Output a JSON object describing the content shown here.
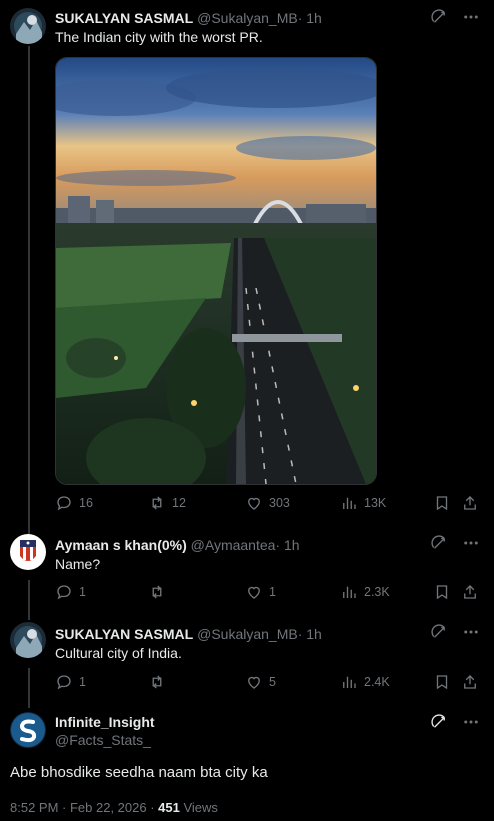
{
  "tweets": [
    {
      "name": "SUKALYAN SASMAL",
      "handle": "@Sukalyan_MB",
      "dot": "·",
      "time": "1h",
      "text": "The Indian city with the worst PR.",
      "replies": "16",
      "retweets": "12",
      "likes": "303",
      "views": "13K"
    },
    {
      "name": "Aymaan s khan(0%)",
      "handle": "@Aymaantea",
      "dot": "·",
      "time": "1h",
      "text": "Name?",
      "replies": "1",
      "retweets": "",
      "likes": "1",
      "views": "2.3K"
    },
    {
      "name": "SUKALYAN SASMAL",
      "handle": "@Sukalyan_MB",
      "dot": "·",
      "time": "1h",
      "text": "Cultural city of India.",
      "replies": "1",
      "retweets": "",
      "likes": "5",
      "views": "2.4K"
    }
  ],
  "focus": {
    "name": "Infinite_Insight",
    "handle": "@Facts_Stats_",
    "text": "Abe bhosdike seedha naam bta city ka",
    "timestamp": "8:52 PM · Feb 22, 2026 ·",
    "views_count": "451",
    "views_label": "Views"
  },
  "colors": {
    "background": "#000000",
    "text": "#e7e9ea",
    "secondary": "#71767b",
    "divider": "#2f3336"
  },
  "icons": [
    "grok-icon",
    "more-icon",
    "reply-icon",
    "retweet-icon",
    "like-icon",
    "views-icon",
    "bookmark-icon",
    "share-icon"
  ]
}
